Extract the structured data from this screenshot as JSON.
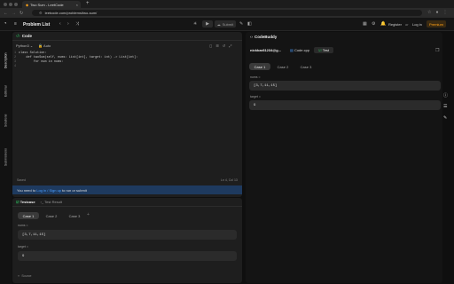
{
  "browser": {
    "tab_title": "Two Sum - LeetCode",
    "url": "leetcode.com/problems/two-sum/",
    "new_tab": "+",
    "close": "×"
  },
  "nav": {
    "problem_list": "Problem List",
    "submit": "Submit",
    "register": "Register",
    "or": "or",
    "login": "Log in",
    "premium": "Premium"
  },
  "sidebar": {
    "items": [
      "Description",
      "Editorial",
      "Solutions",
      "Submissions"
    ]
  },
  "editor": {
    "header": "Code",
    "language": "Python3",
    "mode": "Auto",
    "lines": [
      "class Solution:",
      "    def twoSum(self, nums: List[int], target: int) -> List[int]:",
      "        for num in nums:",
      ""
    ],
    "saved": "Saved",
    "cursor": "Ln 4, Col 13",
    "login_notice": {
      "prefix": "You need to ",
      "link": "Log in / Sign up",
      "suffix": " to run or submit"
    }
  },
  "testcase": {
    "tab_active": "Testcase",
    "tab_result": "Test Result",
    "cases": [
      "Case 1",
      "Case 2",
      "Case 3"
    ],
    "add": "+",
    "nums_label": "nums =",
    "nums_value": "[3,7,11,15]",
    "target_label": "target =",
    "target_value": "9",
    "source": "Source"
  },
  "codebuddy": {
    "title": "CodeBuddy",
    "file_tabs": [
      "nickbar81234@g...",
      "Code.cpp",
      "Test"
    ],
    "cases": [
      "Case 1",
      "Case 2",
      "Case 3"
    ],
    "nums_label": "nums =",
    "nums_value": "[3,7,11,15]",
    "target_label": "target =",
    "target_value": "9"
  },
  "colors": {
    "accent_blue": "#1e5fb4",
    "premium": "#ffa116",
    "submit_green": "#2cbb5d"
  }
}
